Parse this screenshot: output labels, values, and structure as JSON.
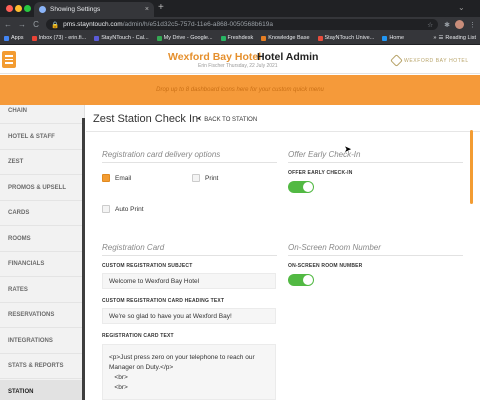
{
  "browser": {
    "tab_title": "Showing Settings",
    "tab_close": "×",
    "new_tab": "+",
    "url_host": "pms.stayntouch.com",
    "url_path": "/admin/h/e51d32c5-757d-11e6-a868-0050568b619a",
    "back": "←",
    "forward": "→",
    "reload": "C",
    "home": "⌂",
    "star": "☆",
    "extensions": "✱",
    "more": "⋮",
    "bookmarks": [
      {
        "label": "Apps",
        "color": "#4285f4"
      },
      {
        "label": "Inbox (73) - erin.fi...",
        "color": "#ea4335"
      },
      {
        "label": "StayNTouch - Cal...",
        "color": "#5a5ad8"
      },
      {
        "label": "My Drive - Google...",
        "color": "#34a853"
      },
      {
        "label": "Freshdesk",
        "color": "#28b463"
      },
      {
        "label": "Knowledge Base",
        "color": "#e67e22"
      },
      {
        "label": "StayNTouch Unive...",
        "color": "#e74c3c"
      },
      {
        "label": "Home",
        "color": "#2196f3"
      }
    ],
    "bookmarks_more": "»",
    "reading_list": "Reading List"
  },
  "header": {
    "hotel_name": "Wexford Bay Hotel",
    "app_name": "Hotel Admin",
    "user_line": "Erin Fischer   Thursday, 22 July 2021",
    "logo_text": "WEXFORD BAY HOTEL",
    "quick_menu_hint": "Drop up to 8 dashboard icons here for your custom quick menu"
  },
  "sidebar": {
    "items": [
      {
        "label": "CHAIN"
      },
      {
        "label": "HOTEL & STAFF"
      },
      {
        "label": "ZEST"
      },
      {
        "label": "PROMOS & UPSELL"
      },
      {
        "label": "CARDS"
      },
      {
        "label": "ROOMS"
      },
      {
        "label": "FINANCIALS"
      },
      {
        "label": "RATES"
      },
      {
        "label": "RESERVATIONS"
      },
      {
        "label": "INTEGRATIONS"
      },
      {
        "label": "STATS & REPORTS"
      },
      {
        "label": "STATION"
      }
    ]
  },
  "main": {
    "page_title": "Zest Station Check In",
    "back_label": "BACK TO STATION",
    "back_arrow": "⮜",
    "registration_delivery": {
      "heading": "Registration card delivery options",
      "email_label": "Email",
      "email_checked": true,
      "print_label": "Print",
      "print_checked": false,
      "auto_print_label": "Auto Print",
      "auto_print_checked": false
    },
    "early_checkin": {
      "heading": "Offer Early Check-In",
      "toggle_label": "OFFER EARLY CHECK-IN",
      "toggle_on": true
    },
    "registration_card": {
      "heading": "Registration Card",
      "subject_label": "CUSTOM REGISTRATION SUBJECT",
      "subject_value": "Welcome  to Wexford Bay Hotel",
      "heading_text_label": "CUSTOM REGISTRATION CARD HEADING TEXT",
      "heading_text_value": "We're so glad to have you at  Wexford Bay!",
      "card_text_label": "REGISTRATION CARD TEXT",
      "card_text_value": "<p>Just press zero on your telephone to reach our\nManager on Duty.</p>\n   <br>\n   <br>"
    },
    "room_number": {
      "heading": "On-Screen Room Number",
      "toggle_label": "ON-SCREEN ROOM NUMBER",
      "toggle_on": true
    }
  },
  "colors": {
    "accent": "#f39c32",
    "toggle_on": "#52b943",
    "hotel_name": "#e5902e"
  }
}
